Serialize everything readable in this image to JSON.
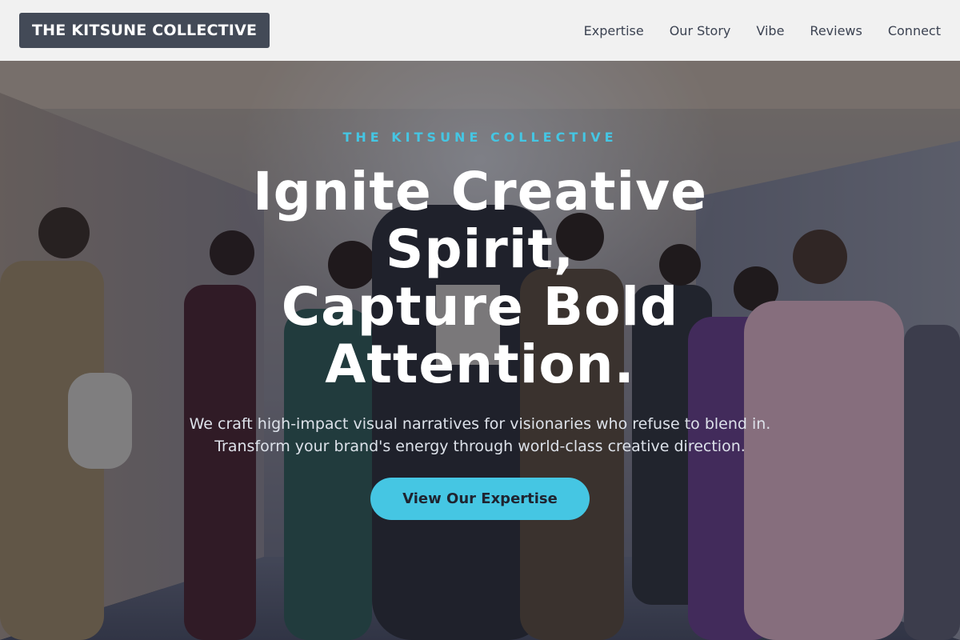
{
  "brand": {
    "logo_text": "THE KITSUNE COLLECTIVE"
  },
  "nav": {
    "items": [
      {
        "label": "Expertise"
      },
      {
        "label": "Our Story"
      },
      {
        "label": "Vibe"
      },
      {
        "label": "Reviews"
      },
      {
        "label": "Connect"
      }
    ]
  },
  "hero": {
    "eyebrow": "THE KITSUNE COLLECTIVE",
    "title_lines": [
      "Ignite Creative",
      "Spirit,",
      "Capture Bold",
      "Attention."
    ],
    "subtitle_lines": [
      "We craft high-impact visual narratives for visionaries who refuse to blend in.",
      "Transform your brand's energy through world-class creative direction."
    ],
    "cta_label": "View Our Expertise",
    "background_image": "fashion-editorial-photo"
  },
  "colors": {
    "accent": "#45c6e3",
    "header_bg": "#f1f1f1",
    "logo_bg": "#434a57",
    "nav_text": "#3c4352",
    "hero_text": "#ffffff"
  }
}
